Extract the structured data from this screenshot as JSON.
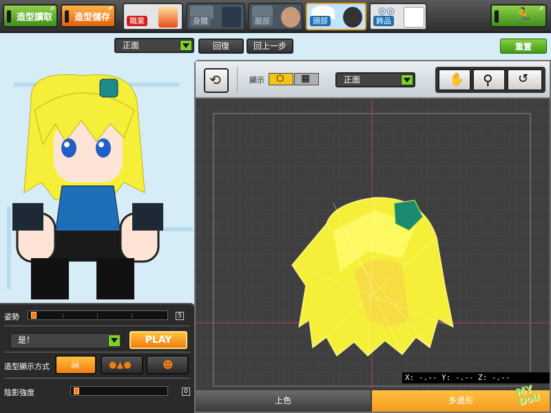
{
  "toolbar": {
    "load_label": "造型讀取",
    "save_label": "造型儲存",
    "exit_icon": "exit-door-icon"
  },
  "categories": [
    {
      "label": "職業",
      "state": "normal"
    },
    {
      "label": "身體",
      "state": "dim"
    },
    {
      "label": "臉部",
      "state": "dim"
    },
    {
      "label": "頭部",
      "state": "active"
    },
    {
      "label": "飾品",
      "state": "normal"
    }
  ],
  "controls": {
    "view_select": "正面",
    "undo_label": "回復",
    "redo_label": "回上一步",
    "reset_label": "重置"
  },
  "editor": {
    "display_label": "顯示",
    "view_select": "正面",
    "coords": "X: -.-- Y: -.-- Z: -.--",
    "tabs": [
      "上色",
      "多邊形"
    ],
    "active_tab": 1
  },
  "panel": {
    "pose_label": "姿勢",
    "pose_value": "5",
    "anim_select": "是！",
    "play_label": "PLAY",
    "display_mode_label": "造型顯示方式",
    "shadow_label": "陰影強度",
    "shadow_value": "0"
  },
  "colors": {
    "accent_green": "#7bd22a",
    "accent_orange": "#f07d10",
    "hair_yellow": "#f5ef3a",
    "active_tab": "#f5a623"
  },
  "watermark": "MY Doll"
}
